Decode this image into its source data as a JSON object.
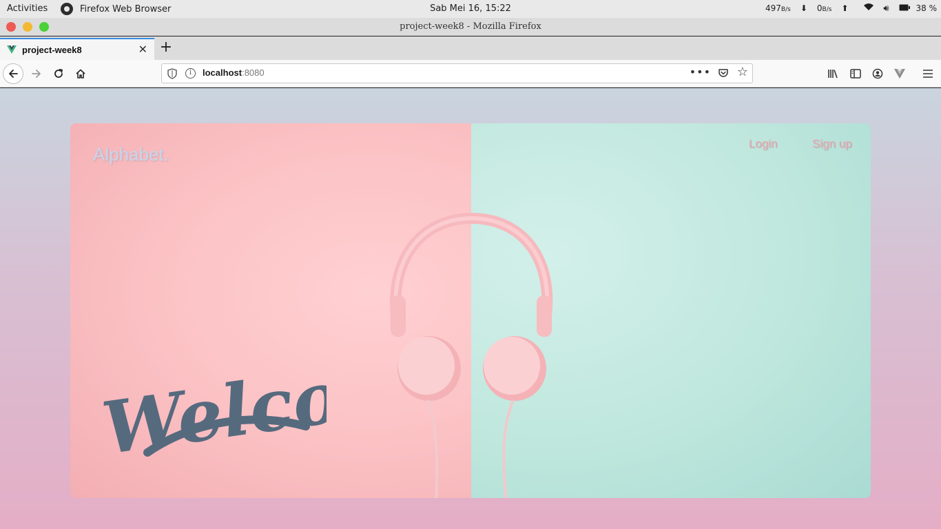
{
  "system_bar": {
    "activities": "Activities",
    "app_name": "Firefox Web Browser",
    "clock": "Sab Mei 16, 15:22",
    "net_down_value": "497",
    "net_down_unit": "B/s",
    "net_up_value": "0",
    "net_up_unit": "B/s",
    "battery": "38 %"
  },
  "window": {
    "title": "project-week8  -  Mozilla  Firefox"
  },
  "tabs": [
    {
      "label": "project-week8",
      "active": true
    }
  ],
  "new_tab_label": "+",
  "address_bar": {
    "host": "localhost",
    "port": ":8080",
    "more_label": "•••"
  },
  "page": {
    "brand": "Alphabet.",
    "nav": {
      "login": "Login",
      "signup": "Sign up"
    },
    "hero_text": "Welcome"
  },
  "colors": {
    "pink_panel": "#fcc4c6",
    "mint_panel": "#bfe7dd",
    "welcome_ink": "#566a7e",
    "brand_text": "#c8d6ea",
    "nav_text": "#e9aab4",
    "tab_accent": "#3b8de0"
  },
  "icons": {
    "app": "firefox-icon",
    "favicon": "vue-logo-icon",
    "back": "arrow-left-icon",
    "forward": "arrow-right-icon",
    "reload": "reload-icon",
    "home": "home-icon",
    "shield": "tracking-shield-icon",
    "info": "info-icon",
    "pocket": "pocket-icon",
    "bookmark": "star-icon",
    "library": "library-icon",
    "sidebar": "sidebar-icon",
    "account": "account-icon",
    "vue_devtools": "vue-devtools-icon",
    "menu": "hamburger-menu-icon"
  }
}
